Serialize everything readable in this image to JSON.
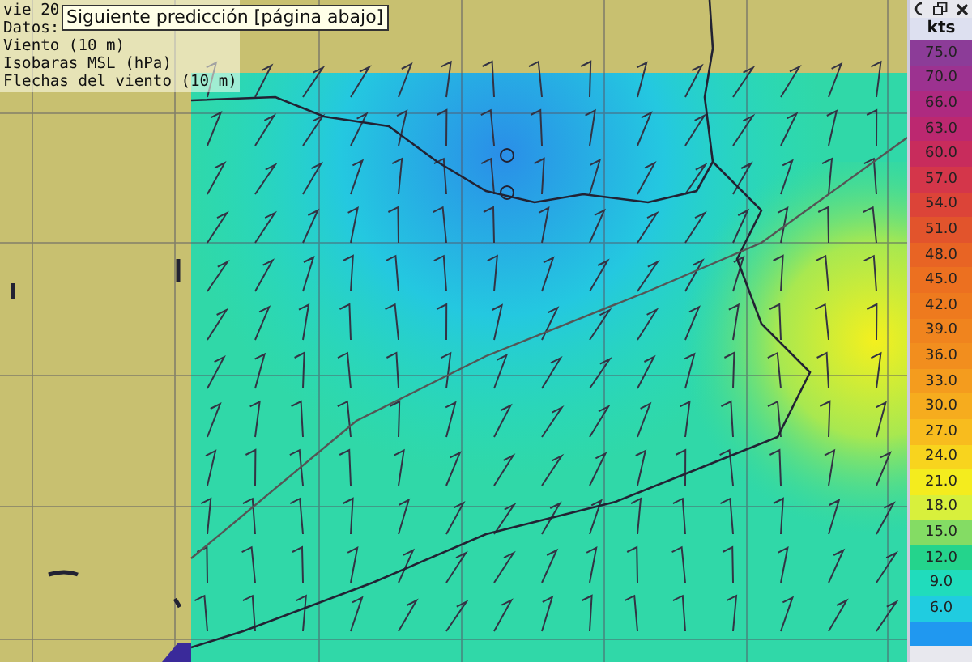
{
  "info": {
    "lines": [
      "vie 20",
      "Datos:",
      "Viento (10 m)",
      "Isobaras MSL (hPa)",
      "Flechas del viento (10 m)"
    ]
  },
  "tooltip": {
    "text": "Siguiente predicción [página abajo]"
  },
  "legend": {
    "unit": "kts",
    "bands": [
      {
        "label": "75.0",
        "color": "#8c3c98"
      },
      {
        "label": "70.0",
        "color": "#9c3290"
      },
      {
        "label": "66.0",
        "color": "#ae2a80"
      },
      {
        "label": "63.0",
        "color": "#bc2870"
      },
      {
        "label": "60.0",
        "color": "#c82c5c"
      },
      {
        "label": "57.0",
        "color": "#d4364a"
      },
      {
        "label": "54.0",
        "color": "#dc4438"
      },
      {
        "label": "51.0",
        "color": "#e2542c"
      },
      {
        "label": "48.0",
        "color": "#e86424"
      },
      {
        "label": "45.0",
        "color": "#ec7020"
      },
      {
        "label": "42.0",
        "color": "#ee7a1e"
      },
      {
        "label": "39.0",
        "color": "#f0841e"
      },
      {
        "label": "36.0",
        "color": "#f28e1e"
      },
      {
        "label": "33.0",
        "color": "#f49c1e"
      },
      {
        "label": "30.0",
        "color": "#f6ac1e"
      },
      {
        "label": "27.0",
        "color": "#f8bc1e"
      },
      {
        "label": "24.0",
        "color": "#f8d41e"
      },
      {
        "label": "21.0",
        "color": "#f4ec1e"
      },
      {
        "label": "18.0",
        "color": "#d8f03c"
      },
      {
        "label": "15.0",
        "color": "#84dc64"
      },
      {
        "label": "12.0",
        "color": "#24d48c"
      },
      {
        "label": "9.0",
        "color": "#20dcbc"
      },
      {
        "label": "6.0",
        "color": "#20cce0"
      },
      {
        "color": "#2098f0"
      }
    ]
  }
}
